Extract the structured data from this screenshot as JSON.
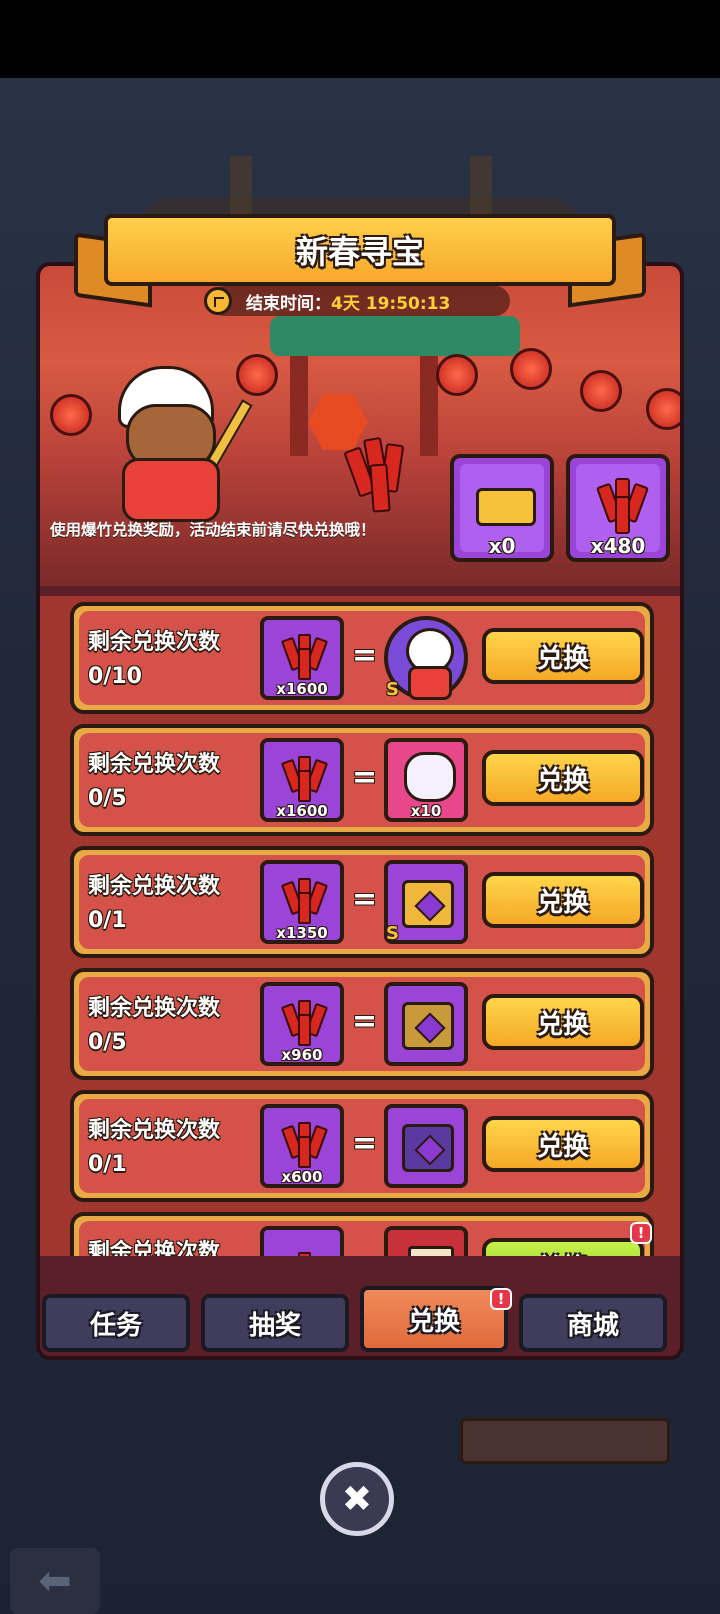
{
  "title": "新春寻宝",
  "timer": {
    "label": "结束时间：",
    "value": "4天 19:50:13"
  },
  "description": "使用爆竹兑换奖励，活动结束前请尽快兑换哦！",
  "resources": [
    {
      "icon": "gold-ticket-icon",
      "count": "x0"
    },
    {
      "icon": "firecracker-icon",
      "count": "x480"
    }
  ],
  "rows": [
    {
      "label": "剩余兑换次数",
      "count": "0/10",
      "cost": "x1600",
      "reward": {
        "icon": "character-portrait-icon",
        "amount": "",
        "grade": "S",
        "color": "#7a4ad8"
      },
      "button": "兑换"
    },
    {
      "label": "剩余兑换次数",
      "count": "0/5",
      "cost": "x1600",
      "reward": {
        "icon": "dragon-pet-icon",
        "amount": "x10",
        "grade": "",
        "color": "#e8488a"
      },
      "button": "兑换"
    },
    {
      "label": "剩余兑换次数",
      "count": "0/1",
      "cost": "x1350",
      "reward": {
        "icon": "treasure-chest-icon",
        "amount": "",
        "grade": "S",
        "color": "#9a44d8"
      },
      "button": "兑换"
    },
    {
      "label": "剩余兑换次数",
      "count": "0/5",
      "cost": "x960",
      "reward": {
        "icon": "mystery-chest-icon",
        "amount": "",
        "grade": "",
        "color": "#9a44d8"
      },
      "button": "兑换"
    },
    {
      "label": "剩余兑换次数",
      "count": "0/1",
      "cost": "x600",
      "reward": {
        "icon": "skull-chest-icon",
        "amount": "",
        "grade": "",
        "color": "#9a44d8"
      },
      "button": "兑换"
    },
    {
      "label": "剩余兑换次数",
      "count": "",
      "cost": "",
      "reward": {
        "icon": "scroll-icon",
        "amount": "",
        "grade": "",
        "color": "#c8303a"
      },
      "button": "兑换"
    }
  ],
  "tabs": [
    "任务",
    "抽奖",
    "兑换",
    "商城"
  ],
  "active_tab": "兑换",
  "close_icon": "close-icon",
  "back_icon": "back-arrow-icon",
  "badge_text": "!"
}
